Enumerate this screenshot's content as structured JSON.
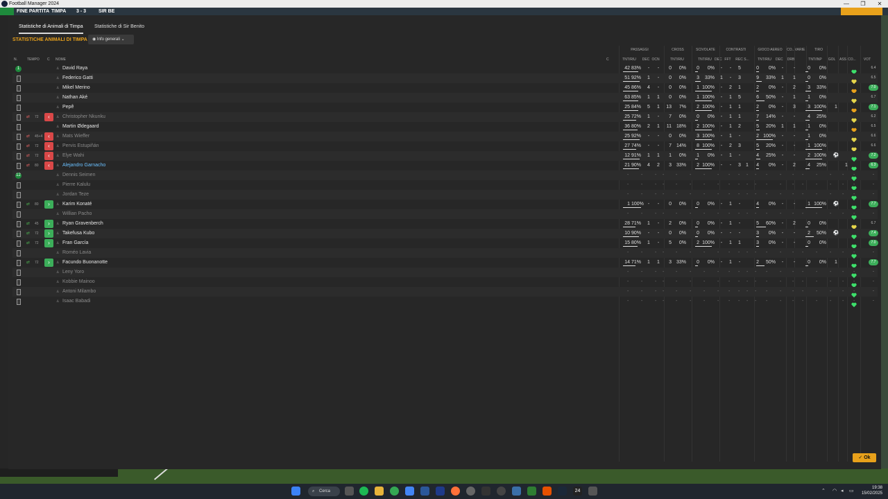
{
  "window": {
    "title": "Football Manager 2024",
    "controls": [
      "—",
      "❐",
      "✕"
    ]
  },
  "topstrip": {
    "result": "FINE PARTITA",
    "home": "TIMPA",
    "score": "3 - 3",
    "away": "SIR BE"
  },
  "tabs": [
    {
      "label": "Statistiche di Animali di Timpa",
      "active": true
    },
    {
      "label": "Statistiche di Sir Benito",
      "active": false
    }
  ],
  "section_title": "STATISTICHE ANIMALI DI TIMPA",
  "view_dropdown": {
    "icon": "eye-icon",
    "label": "Info generali",
    "caret": "chevron-down-icon"
  },
  "groups": [
    "PASSAGGI",
    "CROSS",
    "SCIVOLATE",
    "CONTRASTI",
    "GIOCO AEREO",
    "CO...",
    "VARIE",
    "TIRO"
  ],
  "columns": [
    "N.",
    "TEMPO",
    "C",
    "NOME",
    "C",
    "TNT/RIU",
    "DEC",
    "OCN",
    "TNT/RIU",
    "TNT/RIU",
    "DEC",
    "FFT",
    "REC S...",
    "TNT/RIU",
    "DEC",
    "DRB",
    "TNT/INP",
    "GOL",
    "ASS",
    "CO...",
    "VOT"
  ],
  "players": [
    {
      "n": "1",
      "start": true,
      "name": "David Raya",
      "p": [
        "42",
        "83%"
      ],
      "dec": "-",
      "ocn": "-",
      "cr": [
        "0",
        "0%"
      ],
      "sc": [
        "0",
        "0%"
      ],
      "cd": "-",
      "cf": "-",
      "crs": "5",
      "ae": [
        "0",
        "0%"
      ],
      "co": "-",
      "drb": "-",
      "ti": [
        "0",
        "0%"
      ],
      "gol": "",
      "ass": "",
      "heart": "green",
      "vot": "6.4"
    },
    {
      "n": "",
      "name": "Federico Gatti",
      "p": [
        "51",
        "92%"
      ],
      "dec": "1",
      "ocn": "-",
      "cr": [
        "0",
        "0%"
      ],
      "sc": [
        "3",
        "33%"
      ],
      "cd": "1",
      "cf": "-",
      "crs": "3",
      "ae": [
        "9",
        "33%"
      ],
      "co": "1",
      "drb": "1",
      "ti": [
        "0",
        "0%"
      ],
      "gol": "",
      "ass": "",
      "heart": "yellow",
      "vot": "6.5"
    },
    {
      "n": "",
      "name": "Mikel Merino",
      "p": [
        "45",
        "86%"
      ],
      "dec": "4",
      "ocn": "-",
      "cr": [
        "0",
        "0%"
      ],
      "sc": [
        "1",
        "100%"
      ],
      "cd": "-",
      "cf": "2",
      "crs": "1",
      "ae": [
        "2",
        "0%"
      ],
      "co": "-",
      "drb": "2",
      "ti": [
        "3",
        "33%"
      ],
      "gol": "",
      "ass": "",
      "heart": "orange",
      "vot": "7.0",
      "vot_green": true
    },
    {
      "n": "",
      "name": "Nathan Aké",
      "p": [
        "63",
        "85%"
      ],
      "dec": "1",
      "ocn": "1",
      "cr": [
        "0",
        "0%"
      ],
      "sc": [
        "1",
        "100%"
      ],
      "cd": "-",
      "cf": "1",
      "crs": "5",
      "ae": [
        "6",
        "50%"
      ],
      "co": "-",
      "drb": "1",
      "ti": [
        "1",
        "0%"
      ],
      "gol": "",
      "ass": "",
      "heart": "yellow",
      "vot": "6.7"
    },
    {
      "n": "",
      "name": "Pepê",
      "p": [
        "25",
        "84%"
      ],
      "dec": "5",
      "ocn": "1",
      "cr": [
        "13",
        "7%"
      ],
      "sc": [
        "2",
        "100%"
      ],
      "cd": "-",
      "cf": "1",
      "crs": "1",
      "ae": [
        "2",
        "0%"
      ],
      "co": "-",
      "drb": "3",
      "ti": [
        "3",
        "100%"
      ],
      "gol": "1",
      "ass": "",
      "heart": "orange",
      "vot": "7.1",
      "vot_green": true
    },
    {
      "n": "",
      "sub": "out",
      "time": "72",
      "arrow": "out",
      "name": "Christopher Nkunku",
      "dim": true,
      "p": [
        "25",
        "72%"
      ],
      "dec": "1",
      "ocn": "-",
      "cr": [
        "7",
        "0%"
      ],
      "sc": [
        "0",
        "0%"
      ],
      "cd": "-",
      "cf": "1",
      "crs": "1",
      "ae": [
        "7",
        "14%"
      ],
      "co": "-",
      "drb": "-",
      "ti": [
        "4",
        "25%"
      ],
      "gol": "",
      "ass": "",
      "heart": "yellow",
      "vot": "6.2"
    },
    {
      "n": "",
      "name": "Martin Ødegaard",
      "p": [
        "36",
        "80%"
      ],
      "dec": "2",
      "ocn": "1",
      "cr": [
        "11",
        "18%"
      ],
      "sc": [
        "2",
        "100%"
      ],
      "cd": "-",
      "cf": "1",
      "crs": "2",
      "ae": [
        "5",
        "20%"
      ],
      "co": "1",
      "drb": "1",
      "ti": [
        "1",
        "0%"
      ],
      "gol": "",
      "ass": "",
      "heart": "orange",
      "vot": "6.5"
    },
    {
      "n": "",
      "sub": "out",
      "time": "45+4",
      "arrow": "out",
      "name": "Mats Wieffer",
      "dim": true,
      "p": [
        "25",
        "92%"
      ],
      "dec": "-",
      "ocn": "-",
      "cr": [
        "0",
        "0%"
      ],
      "sc": [
        "3",
        "100%"
      ],
      "cd": "-",
      "cf": "1",
      "crs": "-",
      "ae": [
        "2",
        "100%"
      ],
      "co": "-",
      "drb": "-",
      "ti": [
        "1",
        "0%"
      ],
      "gol": "",
      "ass": "",
      "heart": "yellow",
      "vot": "6.6"
    },
    {
      "n": "",
      "sub": "out",
      "time": "72",
      "arrow": "out",
      "name": "Pervis Estupiñán",
      "dim": true,
      "p": [
        "27",
        "74%"
      ],
      "dec": "-",
      "ocn": "-",
      "cr": [
        "7",
        "14%"
      ],
      "sc": [
        "8",
        "100%"
      ],
      "cd": "-",
      "cf": "2",
      "crs": "3",
      "ae": [
        "5",
        "20%"
      ],
      "co": "-",
      "drb": "-",
      "ti": [
        "1",
        "100%"
      ],
      "gol": "",
      "ass": "",
      "heart": "yellow",
      "vot": "6.6"
    },
    {
      "n": "",
      "sub": "out",
      "time": "72",
      "arrow": "out",
      "name": "Elye Wahi",
      "dim": true,
      "p": [
        "12",
        "91%"
      ],
      "dec": "1",
      "ocn": "1",
      "cr": [
        "1",
        "0%"
      ],
      "sc": [
        "1",
        "0%"
      ],
      "cd": "-",
      "cf": "1",
      "crs": "-",
      "ae": [
        "4",
        "25%"
      ],
      "co": "-",
      "drb": "-",
      "ti": [
        "2",
        "100%"
      ],
      "gol": "⚽",
      "ass": "",
      "heart": "green",
      "vot": "7.2",
      "vot_green": true
    },
    {
      "n": "",
      "sub": "out",
      "time": "80",
      "arrow": "out",
      "name": "Alejandro Garnacho",
      "hl": true,
      "p": [
        "21",
        "90%"
      ],
      "dec": "4",
      "ocn": "2",
      "cr": [
        "3",
        "33%"
      ],
      "sc": [
        "2",
        "100%"
      ],
      "cd": "-",
      "cf": "-",
      "crs": "3",
      "crs2": "1",
      "ae": [
        "4",
        "0%"
      ],
      "co": "-",
      "drb": "2",
      "ti": [
        "4",
        "25%"
      ],
      "gol": "",
      "ass": "1",
      "heart": "green",
      "vot": "6.3",
      "vot_green": true
    },
    {
      "n": "12",
      "start": true,
      "name": "Dennis Seimen",
      "dim": true,
      "empty": true,
      "heart": "green",
      "vot": "-"
    },
    {
      "n": "",
      "name": "Pierre Kalulu",
      "dim": true,
      "empty": true,
      "heart": "green",
      "vot": "-"
    },
    {
      "n": "",
      "name": "Jordan Teze",
      "dim": true,
      "empty": true,
      "heart": "green",
      "vot": "-"
    },
    {
      "n": "",
      "sub": "in",
      "time": "80",
      "arrow": "in",
      "name": "Karim Konaté",
      "p": [
        "1",
        "100%"
      ],
      "dec": "-",
      "ocn": "-",
      "cr": [
        "0",
        "0%"
      ],
      "sc": [
        "0",
        "0%"
      ],
      "cd": "-",
      "cf": "1",
      "crs": "-",
      "ae": [
        "4",
        "0%"
      ],
      "co": "-",
      "drb": "-",
      "ti": [
        "1",
        "100%"
      ],
      "gol": "⚽",
      "ass": "",
      "heart": "green",
      "vot": "7.7",
      "vot_green": true
    },
    {
      "n": "",
      "name": "Willian Pacho",
      "dim": true,
      "empty": true,
      "heart": "green",
      "vot": "-"
    },
    {
      "n": "",
      "sub": "in",
      "time": "45",
      "arrow": "in",
      "name": "Ryan Gravenberch",
      "p": [
        "28",
        "71%"
      ],
      "dec": "1",
      "ocn": "-",
      "cr": [
        "2",
        "0%"
      ],
      "sc": [
        "0",
        "0%"
      ],
      "cd": "-",
      "cf": "1",
      "crs": "-",
      "ae": [
        "5",
        "60%"
      ],
      "co": "-",
      "drb": "2",
      "ti": [
        "0",
        "0%"
      ],
      "gol": "",
      "ass": "",
      "heart": "yellow",
      "vot": "6.7"
    },
    {
      "n": "",
      "sub": "in",
      "time": "72",
      "arrow": "in",
      "name": "Takefusa Kubo",
      "p": [
        "10",
        "90%"
      ],
      "dec": "-",
      "ocn": "-",
      "cr": [
        "0",
        "0%"
      ],
      "sc": [
        "0",
        "0%"
      ],
      "cd": "-",
      "cf": "-",
      "crs": "-",
      "ae": [
        "3",
        "0%"
      ],
      "co": "-",
      "drb": "-",
      "ti": [
        "2",
        "50%"
      ],
      "gol": "⚽",
      "ass": "",
      "heart": "green",
      "vot": "7.4",
      "vot_green": true
    },
    {
      "n": "",
      "sub": "in",
      "time": "72",
      "arrow": "in",
      "name": "Fran García",
      "p": [
        "15",
        "80%"
      ],
      "dec": "1",
      "ocn": "-",
      "cr": [
        "5",
        "0%"
      ],
      "sc": [
        "2",
        "100%"
      ],
      "cd": "-",
      "cf": "1",
      "crs": "1",
      "ae": [
        "3",
        "0%"
      ],
      "co": "-",
      "drb": "-",
      "ti": [
        "0",
        "0%"
      ],
      "gol": "",
      "ass": "",
      "heart": "green",
      "vot": "7.0",
      "vot_green": true
    },
    {
      "n": "",
      "name": "Roméo Lavia",
      "dim": true,
      "empty": true,
      "heart": "green",
      "vot": "-"
    },
    {
      "n": "",
      "sub": "in",
      "time": "72",
      "arrow": "in",
      "name": "Facundo Buonanotte",
      "p": [
        "14",
        "71%"
      ],
      "dec": "1",
      "ocn": "1",
      "cr": [
        "3",
        "33%"
      ],
      "sc": [
        "0",
        "0%"
      ],
      "cd": "-",
      "cf": "1",
      "crs": "-",
      "ae": [
        "2",
        "50%"
      ],
      "co": "-",
      "drb": "-",
      "ti": [
        "0",
        "0%"
      ],
      "gol": "1",
      "ass": "",
      "heart": "green",
      "vot": "7.7",
      "vot_green": true
    },
    {
      "n": "",
      "name": "Leny Yoro",
      "dim": true,
      "empty": true,
      "heart": "green",
      "vot": "-"
    },
    {
      "n": "",
      "name": "Kobbie Mainoo",
      "dim": true,
      "empty": true,
      "heart": "green",
      "vot": "-"
    },
    {
      "n": "",
      "name": "Antoni Milambo",
      "dim": true,
      "empty": true,
      "heart": "green",
      "vot": "-"
    },
    {
      "n": "",
      "name": "Isaac Babadi",
      "dim": true,
      "empty": true,
      "heart": "green",
      "vot": "-"
    }
  ],
  "ok_button": "✓ Ok",
  "taskbar": {
    "search": "Cerca",
    "time": "19:38",
    "date": "15/02/2025",
    "badge": "24"
  },
  "colors": {
    "accent": "#e8a11b",
    "green": "#3cae5a",
    "red": "#d94848",
    "panel": "#272727"
  }
}
